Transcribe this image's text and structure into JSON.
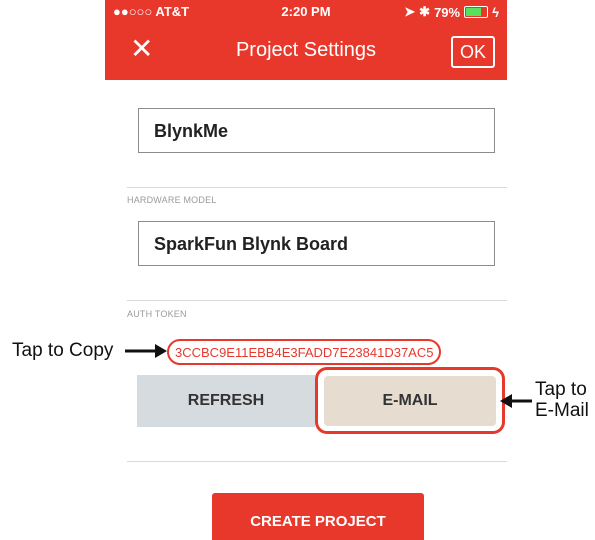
{
  "status_bar": {
    "carrier": "●●○○○ AT&T",
    "time": "2:20 PM",
    "battery": "79%",
    "battery_level": 0.79
  },
  "navbar": {
    "close_icon": "close-icon",
    "title": "Project Settings",
    "ok_label": "OK"
  },
  "project_name": "BlynkMe",
  "hardware": {
    "label": "HARDWARE MODEL",
    "value": "SparkFun Blynk Board"
  },
  "auth": {
    "label": "AUTH TOKEN",
    "token": "3CCBC9E11EBB4E3FADD7E23841D37AC5",
    "refresh_label": "REFRESH",
    "email_label": "E-MAIL"
  },
  "create_label": "CREATE PROJECT",
  "annotations": {
    "left": "Tap to Copy",
    "right_line1": "Tap to",
    "right_line2": "E-Mail"
  },
  "colors": {
    "accent": "#e8382c",
    "refresh_bg": "#d6dbe0",
    "email_bg": "#e6ddd0"
  }
}
